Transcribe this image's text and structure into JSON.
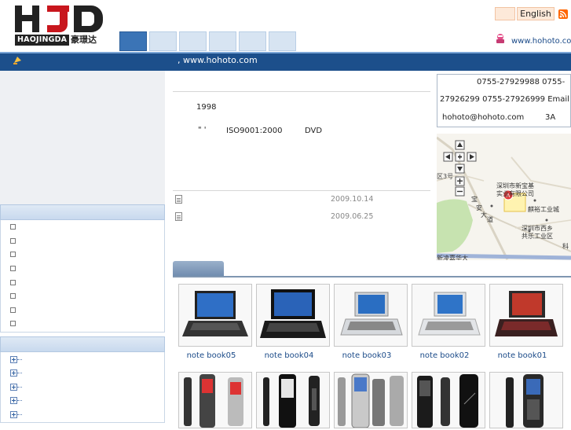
{
  "header": {
    "logo_word": "HAOJINGDA",
    "logo_cn": "豪璟达",
    "language_link": "English",
    "site_url": "www.hohoto.com"
  },
  "bar": {
    "text": ", www.hohoto.com"
  },
  "intro": {
    "year": "1998",
    "quote_marks": "\"    '",
    "iso": "ISO9001:2000",
    "dvd": "DVD"
  },
  "news": [
    {
      "date": "2009.10.14"
    },
    {
      "date": "2009.06.25"
    }
  ],
  "contact": {
    "phone_line1": "0755-27929988   0755-",
    "phone_line2": "27926299 0755-27926999 Email",
    "email": "hohoto@hohoto.com",
    "suffix": "3A"
  },
  "map": {
    "labels": {
      "district": "区3号",
      "company_line1": "深圳市新宝基",
      "company_line2": "实业有限公司",
      "industrial": "麒裕工业城",
      "xixiang_line1": "深圳市西乡",
      "xixiang_line2": "共乐工业区",
      "road_a": "宝",
      "road_b": "安",
      "road_c": "大",
      "road_d": "道",
      "tech": "科",
      "bottom": "新凌嘉华大"
    }
  },
  "products": [
    {
      "name": "note book05"
    },
    {
      "name": "note book04"
    },
    {
      "name": "note book03"
    },
    {
      "name": "note book02"
    },
    {
      "name": "note book01"
    }
  ],
  "colors": {
    "brand_blue": "#1c4f8b",
    "nav_active": "#3b74b6"
  }
}
